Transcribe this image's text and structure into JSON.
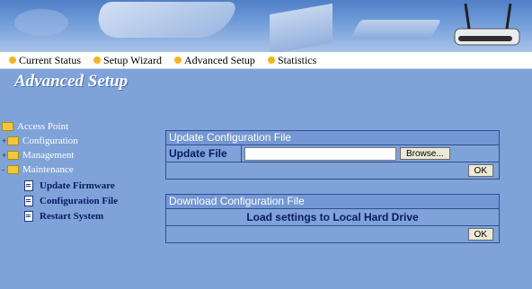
{
  "nav": {
    "items": [
      {
        "label": "Current Status"
      },
      {
        "label": "Setup Wizard"
      },
      {
        "label": "Advanced Setup"
      },
      {
        "label": "Statistics"
      }
    ]
  },
  "page_title": "Advanced Setup",
  "sidebar": {
    "root": "Access Point",
    "folders": [
      "Configuration",
      "Management",
      "Maintenance"
    ],
    "maintenance_items": [
      "Update Firmware",
      "Configuration File",
      "Restart System"
    ]
  },
  "update_panel": {
    "title": "Update Configuration File",
    "field_label": "Update File",
    "file_value": "",
    "browse_label": "Browse...",
    "ok_label": "OK"
  },
  "download_panel": {
    "title": "Download Configuration File",
    "text": "Load settings to Local Hard Drive",
    "ok_label": "OK"
  },
  "colors": {
    "background": "#7fa2d8",
    "nav_dot": "#f3b520",
    "border": "#2d4f9a",
    "label_text": "#0a1a66"
  },
  "icons": [
    "folder-icon",
    "document-icon",
    "router-icon",
    "nav-bullet-icon"
  ]
}
